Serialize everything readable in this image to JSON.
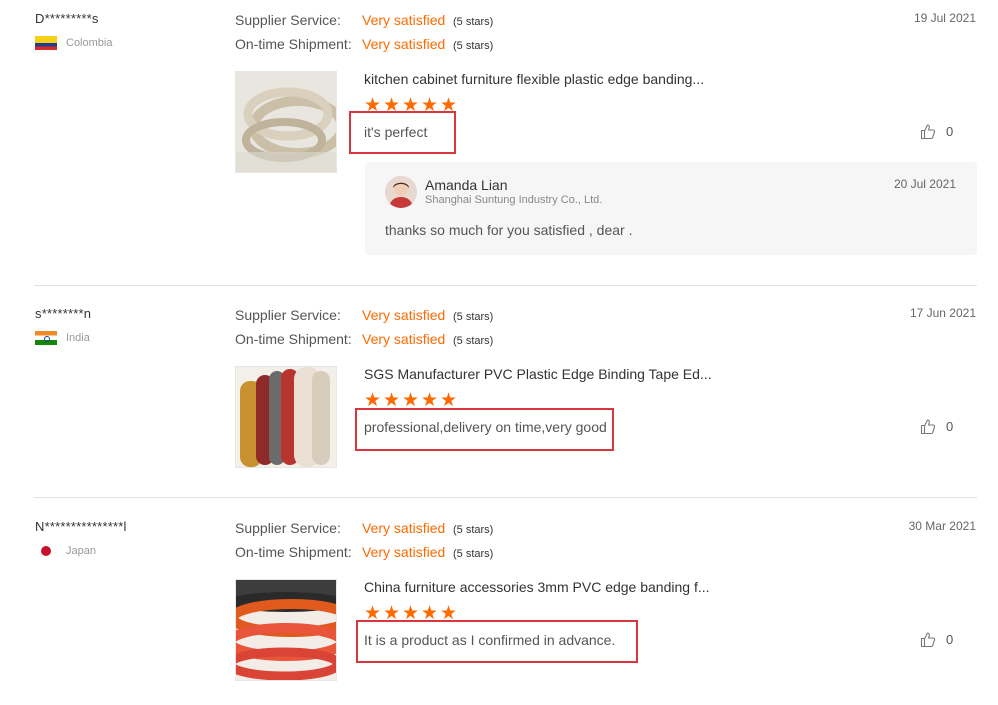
{
  "labels": {
    "supplier_service": "Supplier Service:",
    "ontime_shipment": "On-time Shipment:"
  },
  "colors": {
    "accent": "#ff6a00",
    "highlight_box": "#d9363e",
    "reply_bg": "#f6f6f6"
  },
  "reviews": [
    {
      "buyer": "D*********s",
      "country": "Colombia",
      "flag_icon": "colombia-flag-icon",
      "supplier_service": {
        "value": "Very satisfied",
        "stars_text": "(5 stars)"
      },
      "ontime_shipment": {
        "value": "Very satisfied",
        "stars_text": "(5 stars)"
      },
      "date": "19 Jul 2021",
      "product_title": "kitchen cabinet furniture flexible plastic edge banding...",
      "rating": 5,
      "comment": "it's perfect",
      "likes": "0",
      "reply": {
        "name": "Amanda Lian",
        "company": "Shanghai Suntung Industry Co., Ltd.",
        "date": "20 Jul 2021",
        "text": "thanks so  much for you satisfied , dear ."
      }
    },
    {
      "buyer": "s********n",
      "country": "India",
      "flag_icon": "india-flag-icon",
      "supplier_service": {
        "value": "Very satisfied",
        "stars_text": "(5 stars)"
      },
      "ontime_shipment": {
        "value": "Very satisfied",
        "stars_text": "(5 stars)"
      },
      "date": "17 Jun 2021",
      "product_title": "SGS Manufacturer PVC Plastic Edge Binding Tape Ed...",
      "rating": 5,
      "comment": "professional,delivery on time,very good",
      "likes": "0"
    },
    {
      "buyer": "N***************l",
      "country": "Japan",
      "flag_icon": "japan-flag-icon",
      "supplier_service": {
        "value": "Very satisfied",
        "stars_text": "(5 stars)"
      },
      "ontime_shipment": {
        "value": "Very satisfied",
        "stars_text": "(5 stars)"
      },
      "date": "30 Mar 2021",
      "product_title": "China furniture accessories 3mm PVC edge banding f...",
      "rating": 5,
      "comment": "It is a product as I confirmed in advance.",
      "likes": "0"
    }
  ]
}
